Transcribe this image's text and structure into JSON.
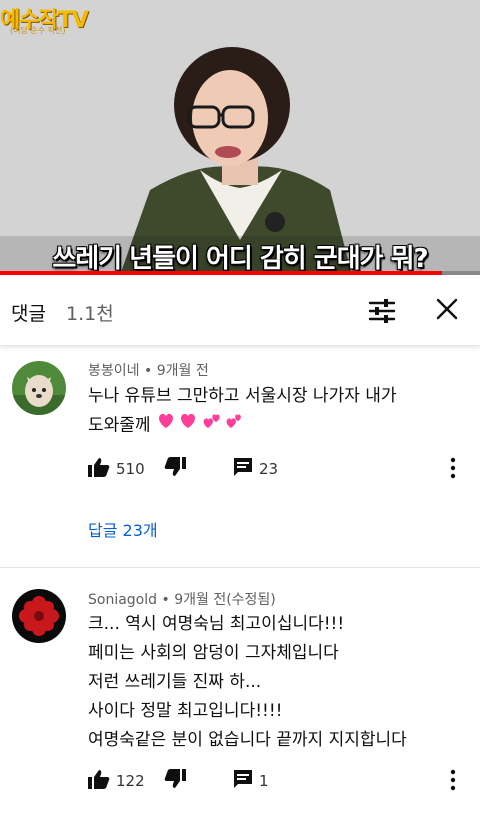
{
  "video": {
    "channel_logo": "예수작TV",
    "channel_logo_sub": "(여당 순수 작전)",
    "caption": "쓰레기 년들이 어디 감히 군대가 뭐?",
    "progress": 0.92
  },
  "comments_header": {
    "title": "댓글",
    "count": "1.1천"
  },
  "comments": [
    {
      "author": "봉봉이네",
      "separator": " • ",
      "time": "9개월 전",
      "lines": [
        "누나 유튜브 그만하고 서울시장 나가자 내가",
        "도와줄께"
      ],
      "likes": "510",
      "replies_count": "23",
      "replies_link": "답글 23개"
    },
    {
      "author": "Soniagold",
      "separator": " • ",
      "time": "9개월 전(수정됨)",
      "lines": [
        "크... 역시 여명숙님 최고이십니다!!!",
        "페미는 사회의 암덩이 그자체입니다",
        "저런 쓰레기들 진짜 하...",
        "사이다 정말 최고입니다!!!!",
        "여명숙같은 분이 없습니다 끝까지 지지합니다"
      ],
      "likes": "122",
      "replies_count": "1"
    }
  ],
  "colors": {
    "accent_link": "#065fd4",
    "progress": "#ff0000",
    "meta_text": "#606060"
  },
  "icons": {
    "filter": "sort-sliders-icon",
    "close": "close-icon",
    "like": "thumbs-up-icon",
    "dislike": "thumbs-down-icon",
    "reply": "comment-icon",
    "more": "more-vertical-icon"
  }
}
